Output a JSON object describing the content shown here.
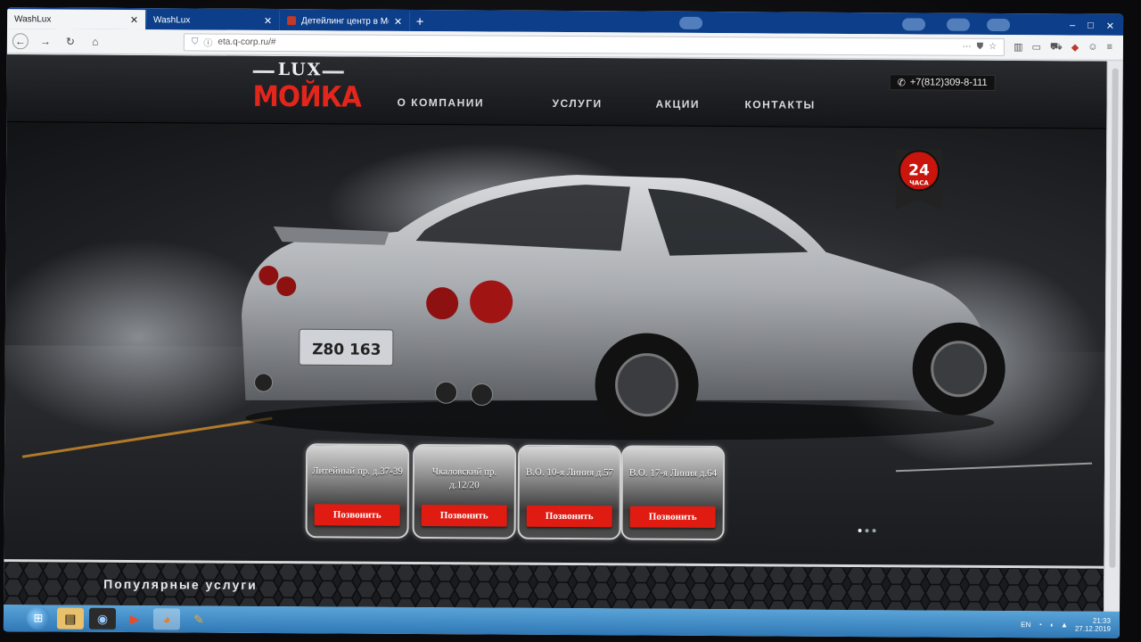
{
  "browser": {
    "tabs": [
      {
        "title": "WashLux",
        "active": true
      },
      {
        "title": "WashLux",
        "active": false
      },
      {
        "title": "Детейлинг центр в Москве (…",
        "active": false
      }
    ],
    "new_tab": "+",
    "window_controls": [
      "–",
      "□",
      "✕"
    ],
    "url": "eta.q-corp.ru/#"
  },
  "site": {
    "logo_top": "LUX",
    "logo_main": "МОЙКА",
    "menu": [
      "О компании",
      "Услуги",
      "Акции",
      "Контакты"
    ],
    "phone": "+7(812)309-8-111",
    "badge_number": "24",
    "badge_text": "ЧАСА",
    "plate": "Z80 163",
    "branches": [
      {
        "address": "Литейный пр. д.37-39",
        "button": "Позвонить"
      },
      {
        "address": "Чкаловский пр. д.12/20",
        "button": "Позвонить"
      },
      {
        "address": "В.О. 10-я Линия д.57",
        "button": "Позвонить"
      },
      {
        "address": "В.О. 17-я Линия д.64",
        "button": "Позвонить"
      }
    ],
    "popular_title": "Популярные услуги"
  },
  "taskbar": {
    "lang": "EN",
    "time": "21:33",
    "date": "27.12.2019"
  },
  "colors": {
    "brand_red": "#e3261b",
    "call_button": "#e01c12",
    "tab_bar": "#0c3e8a",
    "taskbar": "#2f78b6"
  }
}
